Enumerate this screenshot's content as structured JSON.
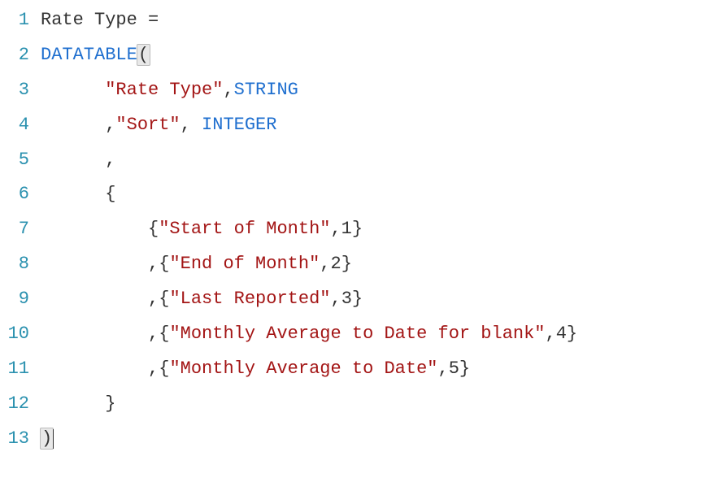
{
  "code": {
    "lines": [
      {
        "num": "1",
        "indent": "",
        "tokens": [
          {
            "t": "Rate Type = ",
            "c": "plain"
          }
        ]
      },
      {
        "num": "2",
        "indent": "",
        "tokens": [
          {
            "t": "DATATABLE",
            "c": "keyword"
          },
          {
            "t": "(",
            "c": "punct",
            "hl": true
          }
        ]
      },
      {
        "num": "3",
        "indent": "      ",
        "tokens": [
          {
            "t": "\"Rate Type\"",
            "c": "string"
          },
          {
            "t": ",",
            "c": "punct"
          },
          {
            "t": "STRING",
            "c": "keyword"
          }
        ]
      },
      {
        "num": "4",
        "indent": "      ",
        "tokens": [
          {
            "t": ",",
            "c": "punct"
          },
          {
            "t": "\"Sort\"",
            "c": "string"
          },
          {
            "t": ", ",
            "c": "punct"
          },
          {
            "t": "INTEGER",
            "c": "keyword"
          }
        ]
      },
      {
        "num": "5",
        "indent": "      ",
        "tokens": [
          {
            "t": ",",
            "c": "punct"
          }
        ]
      },
      {
        "num": "6",
        "indent": "      ",
        "tokens": [
          {
            "t": "{",
            "c": "punct"
          }
        ]
      },
      {
        "num": "7",
        "indent": "          ",
        "tokens": [
          {
            "t": "{",
            "c": "punct"
          },
          {
            "t": "\"Start of Month\"",
            "c": "string"
          },
          {
            "t": ",",
            "c": "punct"
          },
          {
            "t": "1",
            "c": "number"
          },
          {
            "t": "}",
            "c": "punct"
          }
        ]
      },
      {
        "num": "8",
        "indent": "          ",
        "tokens": [
          {
            "t": ",{",
            "c": "punct"
          },
          {
            "t": "\"End of Month\"",
            "c": "string"
          },
          {
            "t": ",",
            "c": "punct"
          },
          {
            "t": "2",
            "c": "number"
          },
          {
            "t": "}",
            "c": "punct"
          }
        ]
      },
      {
        "num": "9",
        "indent": "          ",
        "tokens": [
          {
            "t": ",{",
            "c": "punct"
          },
          {
            "t": "\"Last Reported\"",
            "c": "string"
          },
          {
            "t": ",",
            "c": "punct"
          },
          {
            "t": "3",
            "c": "number"
          },
          {
            "t": "}",
            "c": "punct"
          }
        ]
      },
      {
        "num": "10",
        "indent": "          ",
        "tokens": [
          {
            "t": ",{",
            "c": "punct"
          },
          {
            "t": "\"Monthly Average to Date for blank\"",
            "c": "string"
          },
          {
            "t": ",",
            "c": "punct"
          },
          {
            "t": "4",
            "c": "number"
          },
          {
            "t": "}",
            "c": "punct"
          }
        ]
      },
      {
        "num": "11",
        "indent": "          ",
        "tokens": [
          {
            "t": ",{",
            "c": "punct"
          },
          {
            "t": "\"Monthly Average to Date\"",
            "c": "string"
          },
          {
            "t": ",",
            "c": "punct"
          },
          {
            "t": "5",
            "c": "number"
          },
          {
            "t": "}",
            "c": "punct"
          }
        ]
      },
      {
        "num": "12",
        "indent": "      ",
        "tokens": [
          {
            "t": "}",
            "c": "punct"
          }
        ]
      },
      {
        "num": "13",
        "indent": "",
        "tokens": [
          {
            "t": ")",
            "c": "punct",
            "hl": true,
            "cursorAfter": true
          }
        ]
      }
    ]
  }
}
